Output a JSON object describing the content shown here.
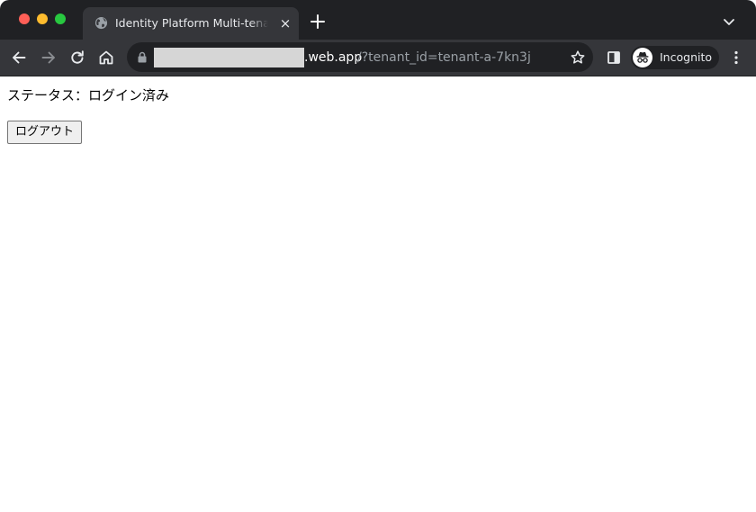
{
  "browser": {
    "tab": {
      "title": "Identity Platform Multi-tenant Demo",
      "close_glyph": "×"
    },
    "address_bar": {
      "url_domain": ".web.app",
      "url_path": "/?tenant_id=tenant-a-7kn3j"
    },
    "profile": {
      "label": "Incognito"
    },
    "colors": {
      "tabstrip": "#202124",
      "toolbar": "#35363a",
      "traffic_close": "#ff5f57",
      "traffic_minimize": "#febc2e",
      "traffic_zoom": "#28c840"
    }
  },
  "page": {
    "status_text": "ステータス：ログイン済み",
    "logout_label": "ログアウト"
  }
}
